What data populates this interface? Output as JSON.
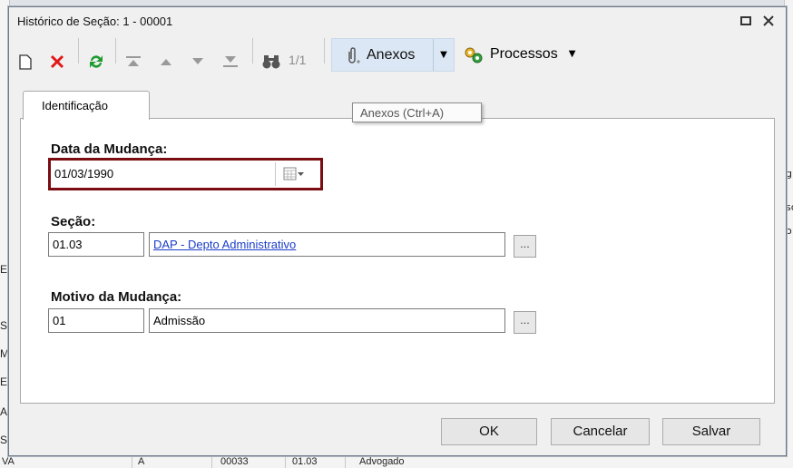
{
  "window": {
    "title": "Histórico de Seção: 1 - 00001"
  },
  "toolbar": {
    "pager": "1/1",
    "anexos_label": "Anexos",
    "processos_label": "Processos",
    "tooltip": "Anexos (Ctrl+A)",
    "icons": [
      "new-document-icon",
      "delete-icon",
      "refresh-icon",
      "first-record-icon",
      "previous-record-icon",
      "next-record-icon",
      "last-record-icon",
      "search-binoculars-icon",
      "paperclip-icon",
      "process-gears-icon"
    ]
  },
  "tabs": [
    {
      "label": "Identificação"
    }
  ],
  "form": {
    "data_mudanca": {
      "label": "Data da Mudança:",
      "value": "01/03/1990"
    },
    "secao": {
      "label": "Seção:",
      "code": "01.03",
      "description": "DAP - Depto Administrativo",
      "browse": "..."
    },
    "motivo": {
      "label": "Motivo da Mudança:",
      "code": "01",
      "description": "Admissão",
      "browse": "..."
    }
  },
  "buttons": {
    "ok": "OK",
    "cancel": "Cancelar",
    "save": "Salvar"
  },
  "background": {
    "left_items": [
      "E",
      "S",
      "M",
      "E",
      "AL",
      "SC"
    ],
    "right_items": [
      "g",
      "sc",
      "o"
    ],
    "bottom_items": [
      "VA",
      "A",
      "00033",
      "01.03",
      "Advogado"
    ]
  },
  "colors": {
    "highlight_border": "#7b0d12",
    "link": "#1a3cc9",
    "anexos_bg": "#dbe7f4"
  }
}
